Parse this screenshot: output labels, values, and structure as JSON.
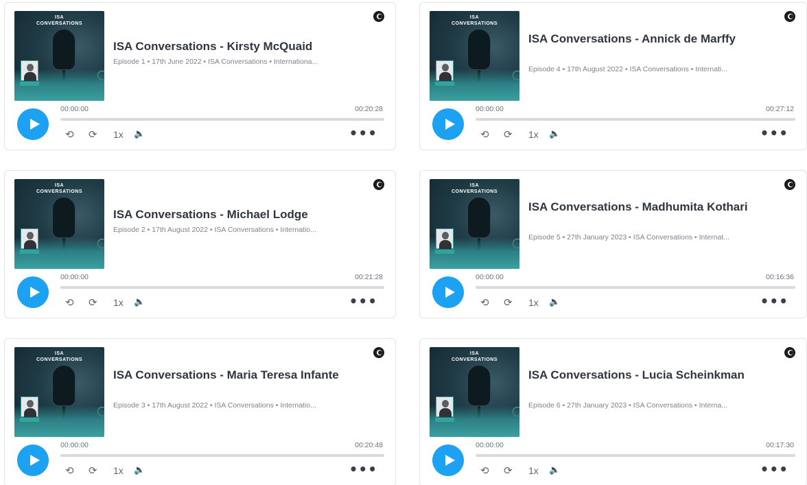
{
  "artwork": {
    "line1": "ISA",
    "line2": "CONVERSATIONS"
  },
  "controls": {
    "rewind_icon": "rewind-icon",
    "forward_icon": "fast-forward-icon",
    "rate": "1x",
    "volume_icon": "volume-icon",
    "more": "•••"
  },
  "colors": {
    "play": "#1da1f2",
    "track": "#d8dade",
    "artwork_bg": "#1f3b45",
    "artwork_reef": "#2d7f86"
  },
  "episodes": [
    {
      "title": "ISA Conversations - Kirsty McQuaid",
      "meta": "Episode 1 • 17th June 2022 • ISA Conversations • Internationa...",
      "current": "00:00:00",
      "duration": "00:20:28"
    },
    {
      "title": "ISA Conversations - Annick de Marffy",
      "meta": "Episode 4 • 17th August 2022 • ISA Conversations • Internati...",
      "current": "00:00:00",
      "duration": "00:27:12"
    },
    {
      "title": "ISA Conversations - Michael Lodge",
      "meta": "Episode 2 • 17th August 2022 • ISA Conversations • Internatio...",
      "current": "00:00:00",
      "duration": "00:21:28"
    },
    {
      "title": "ISA Conversations - Madhumita Kothari",
      "meta": "Episode 5 • 27th January 2023 • ISA Conversations • Internat...",
      "current": "00:00:00",
      "duration": "00:16:36"
    },
    {
      "title": "ISA Conversations - Maria Teresa Infante",
      "meta": "Episode 3 • 17th August 2022 • ISA Conversations • Internatio...",
      "current": "00:00:00",
      "duration": "00:20:48"
    },
    {
      "title": "ISA Conversations - Lucia Scheinkman",
      "meta": "Episode 6 • 27th January 2023 • ISA Conversations • Interna...",
      "current": "00:00:00",
      "duration": "00:17:30"
    }
  ]
}
